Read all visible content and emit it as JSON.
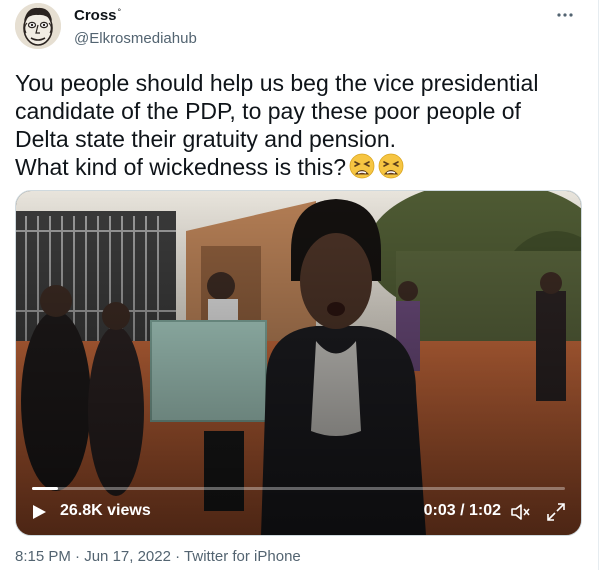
{
  "author": {
    "display_name": "Cross",
    "name_mark": "°",
    "handle": "@Elkrosmediahub"
  },
  "more_icon": "more-horizontal-icon",
  "tweet": {
    "lines": [
      "You people should help us beg the vice presidential",
      "candidate of the PDP, to pay these poor people of",
      "Delta state their gratuity and pension.",
      "What kind of wickedness is this?"
    ],
    "emoji": [
      "weary-face-emoji",
      "weary-face-emoji"
    ]
  },
  "video": {
    "views": "26.8K views",
    "time": "0:03 / 1:02",
    "progress": 0.048,
    "icons": [
      "play-icon",
      "volume-muted-icon",
      "fullscreen-icon"
    ]
  },
  "meta": {
    "time": "8:15 PM",
    "sep1": " · ",
    "date": "Jun 17, 2022",
    "sep2": " · ",
    "source": "Twitter for iPhone"
  },
  "colors": {
    "text": "#0f1419",
    "secondary": "#536471",
    "emoji": "#f6c542"
  }
}
